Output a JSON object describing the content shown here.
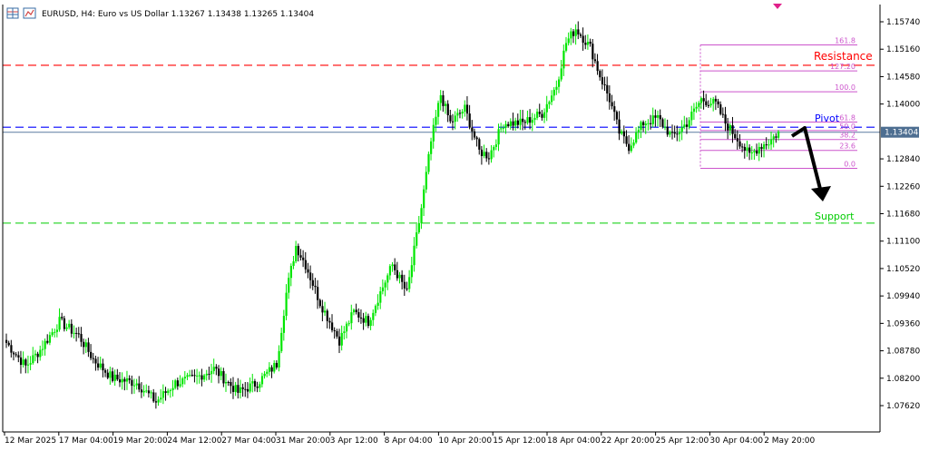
{
  "header": {
    "symbol_line": "EURUSD, H4:  Euro vs US Dollar  1.13267 1.13438 1.13265 1.13404"
  },
  "colors": {
    "bull": "#00e600",
    "bear": "#000000",
    "resistance": "#ff0000",
    "pivot": "#0000ff",
    "support": "#00cc00",
    "fib": "#cc55cc",
    "price_tag_bg": "#4d6e91"
  },
  "chart_data": {
    "type": "candlestick",
    "symbol": "EURUSD",
    "timeframe": "H4",
    "y_ticks": [
      "1.15740",
      "1.15160",
      "1.14580",
      "1.14000",
      "1.13404",
      "1.12840",
      "1.12260",
      "1.11680",
      "1.11100",
      "1.10520",
      "1.09940",
      "1.09360",
      "1.08780",
      "1.08200",
      "1.07620"
    ],
    "x_ticks": [
      "12 Mar 2025",
      "17 Mar 04:00",
      "19 Mar 20:00",
      "24 Mar 12:00",
      "27 Mar 04:00",
      "31 Mar 20:00",
      "3 Apr 12:00",
      "8 Apr 04:00",
      "10 Apr 20:00",
      "15 Apr 12:00",
      "18 Apr 04:00",
      "22 Apr 20:00",
      "25 Apr 12:00",
      "30 Apr 04:00",
      "2 May 20:00"
    ],
    "ylim": [
      1.0715,
      1.1605
    ],
    "current_price": "1.13404",
    "lines": {
      "resistance": {
        "label": "Resistance",
        "value": 1.1482
      },
      "pivot": {
        "label": "Pivot",
        "value": 1.1351
      },
      "support": {
        "label": "Support",
        "value": 1.1148
      }
    },
    "fibonacci": [
      {
        "label": "161.8",
        "value": 1.1525
      },
      {
        "label": "127.20",
        "value": 1.147
      },
      {
        "label": "100.0",
        "value": 1.1426
      },
      {
        "label": "61.8",
        "value": 1.1362
      },
      {
        "label": "50.0",
        "value": 1.1344
      },
      {
        "label": "38.2",
        "value": 1.1325
      },
      {
        "label": "23.6",
        "value": 1.1302
      },
      {
        "label": "0.0",
        "value": 1.1264
      }
    ],
    "anchors": [
      [
        0,
        1.0895
      ],
      [
        8,
        1.0845
      ],
      [
        14,
        1.088
      ],
      [
        22,
        1.094
      ],
      [
        30,
        1.091
      ],
      [
        36,
        1.086
      ],
      [
        44,
        1.082
      ],
      [
        54,
        1.081
      ],
      [
        62,
        1.077
      ],
      [
        70,
        1.081
      ],
      [
        78,
        1.082
      ],
      [
        86,
        1.084
      ],
      [
        96,
        1.079
      ],
      [
        104,
        1.081
      ],
      [
        112,
        1.085
      ],
      [
        116,
        1.1
      ],
      [
        120,
        1.11
      ],
      [
        124,
        1.106
      ],
      [
        130,
        1.098
      ],
      [
        138,
        1.09
      ],
      [
        144,
        1.096
      ],
      [
        150,
        1.094
      ],
      [
        154,
        1.099
      ],
      [
        160,
        1.106
      ],
      [
        166,
        1.1
      ],
      [
        172,
        1.118
      ],
      [
        176,
        1.132
      ],
      [
        180,
        1.142
      ],
      [
        184,
        1.136
      ],
      [
        190,
        1.139
      ],
      [
        196,
        1.13
      ],
      [
        200,
        1.129
      ],
      [
        206,
        1.136
      ],
      [
        214,
        1.136
      ],
      [
        222,
        1.138
      ],
      [
        228,
        1.144
      ],
      [
        232,
        1.153
      ],
      [
        236,
        1.156
      ],
      [
        242,
        1.152
      ],
      [
        246,
        1.146
      ],
      [
        250,
        1.141
      ],
      [
        254,
        1.134
      ],
      [
        258,
        1.131
      ],
      [
        264,
        1.136
      ],
      [
        270,
        1.137
      ],
      [
        276,
        1.133
      ],
      [
        282,
        1.136
      ],
      [
        288,
        1.141
      ],
      [
        294,
        1.14
      ],
      [
        298,
        1.136
      ],
      [
        304,
        1.132
      ],
      [
        308,
        1.129
      ],
      [
        312,
        1.131
      ],
      [
        316,
        1.132
      ],
      [
        320,
        1.134
      ]
    ]
  }
}
